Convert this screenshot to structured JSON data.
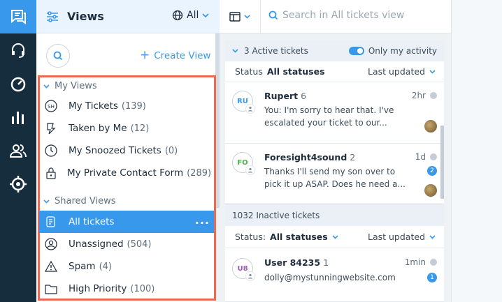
{
  "rail": {
    "items": [
      "chat-icon",
      "headset-icon",
      "dashboard-icon",
      "reports-icon",
      "contacts-icon",
      "settings-icon"
    ]
  },
  "views": {
    "title": "Views",
    "scope": "All",
    "create_label": "Create View",
    "my_views_title": "My Views",
    "my_views": [
      {
        "label": "My Tickets",
        "count": "(139)",
        "icon": "sh-icon"
      },
      {
        "label": "Taken by Me",
        "count": "(12)",
        "icon": "taken-icon"
      },
      {
        "label": "My Snoozed Tickets",
        "count": "(0)",
        "icon": "clock-icon"
      },
      {
        "label": "My Private Contact Form",
        "count": "(289)",
        "icon": "lock-icon"
      }
    ],
    "shared_views_title": "Shared Views",
    "shared_views": [
      {
        "label": "All tickets",
        "count": "",
        "icon": "tickets-icon",
        "selected": true
      },
      {
        "label": "Unassigned",
        "count": "(504)",
        "icon": "user-icon"
      },
      {
        "label": "Spam",
        "count": "(4)",
        "icon": "warning-icon"
      },
      {
        "label": "High Priority",
        "count": "(100)",
        "icon": "folder-icon"
      }
    ]
  },
  "tickets": {
    "search_placeholder": "Search in All tickets view",
    "active": {
      "title": "3 Active tickets",
      "toggle_label": "Only my activity",
      "status_label": "Status",
      "status_value": "All statuses",
      "sort": "Last updated",
      "items": [
        {
          "initials": "RU",
          "name": "Rupert",
          "count": "6",
          "time": "2hr",
          "message": "You: I'm sorry to hear that. I've escalated your ticket to our...",
          "badge": ""
        },
        {
          "initials": "FO",
          "name": "Foresight4sound",
          "count": "2",
          "time": "1d",
          "message": "Thanks I'll send my son over to pick it up ASAP. Does he need a...",
          "badge": "2"
        }
      ]
    },
    "inactive": {
      "title": "1032 Inactive tickets",
      "status_label": "Status:",
      "status_value": "All statuses",
      "sort": "Last updated",
      "items": [
        {
          "initials": "U8",
          "name": "User 84235",
          "count": "1",
          "time": "1min",
          "message": "dolly@mystunningwebsite.com",
          "badge": "1"
        }
      ]
    }
  },
  "colors": {
    "rail": "#162d3d",
    "accent": "#3899ec",
    "highlight": "#ea6a52"
  }
}
